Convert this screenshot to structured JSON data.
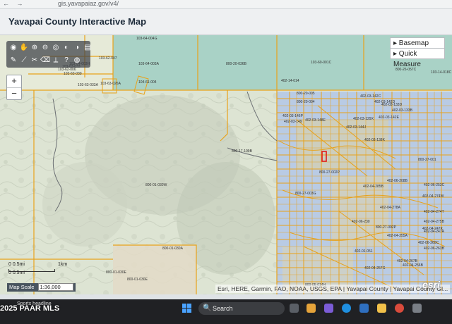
{
  "browser": {
    "nav_icons": "← →",
    "url": "gis.yavapaiaz.gov/v4/"
  },
  "app": {
    "title": "Yavapai County Interactive Map"
  },
  "panel": {
    "basemap_label": "▸ Basemap",
    "quick_measure_label": "▸ Quick Measure"
  },
  "zoom": {
    "in_label": "+",
    "out_label": "−"
  },
  "toolbar": {
    "tools": [
      {
        "name": "identify-icon",
        "glyph": "◉"
      },
      {
        "name": "pan-hand-icon",
        "glyph": "✋"
      },
      {
        "name": "zoom-in-tool-icon",
        "glyph": "⊕"
      },
      {
        "name": "zoom-out-tool-icon",
        "glyph": "⊖"
      },
      {
        "name": "full-extent-icon",
        "glyph": "◎"
      },
      {
        "name": "previous-extent-icon",
        "glyph": "◐"
      },
      {
        "name": "next-extent-icon",
        "glyph": "◑"
      },
      {
        "name": "print-icon",
        "glyph": "▤"
      },
      {
        "name": "draw-pencil-icon",
        "glyph": "✎"
      },
      {
        "name": "measure-icon",
        "glyph": "⟋"
      },
      {
        "name": "scissors-icon",
        "glyph": "✂"
      },
      {
        "name": "eraser-icon",
        "glyph": "⌫"
      },
      {
        "name": "pipe-icon",
        "glyph": "⟂"
      },
      {
        "name": "help-icon",
        "glyph": "?"
      },
      {
        "name": "globe-icon",
        "glyph": "◍"
      }
    ]
  },
  "map": {
    "parcel_labels": [
      "103-64-004G",
      "103-62-007",
      "103-64-003A",
      "103-62-006",
      "103-63-030",
      "103-63-033",
      "103-63-033A",
      "104-61-004",
      "103-63-026A",
      "103-64-003H",
      "800-20-036B",
      "103-60-001C",
      "800-26-057C",
      "103-14-018C",
      "402-14-014",
      "800-20-005",
      "800-20-004",
      "402-03-142C",
      "402-03-142D",
      "402-03-133D",
      "402-03-133B",
      "402-03-129X",
      "402-03-146P",
      "402-03-149",
      "402-03-148E",
      "402-03-142E",
      "402-03-144J",
      "402-03-138K",
      "800-27-001",
      "800-17-109B",
      "800-27-002P",
      "800-27-003G",
      "402-06-208B",
      "402-04-285B",
      "402-04-274W",
      "402-06-253C",
      "402-04-278A",
      "402-04-274T",
      "402-04-275B",
      "402-04-247K",
      "800-27-002P",
      "402-06-230",
      "402-04-247A",
      "402-04-255A",
      "402-06-260C",
      "402-06-263B",
      "402-01-051",
      "402-04-267B",
      "402-04-256B",
      "402-04-257G",
      "800-05-014H",
      "800-01-030W",
      "800-01-030E",
      "800-01-030A",
      "800-01-030E"
    ]
  },
  "scale": {
    "left_label": "0 0.5mi",
    "right_label": "1km",
    "bottom_label": "0 0.5mi",
    "map_scale_label": "Map Scale",
    "map_scale_value": "1:36,000"
  },
  "attribution": "Esri, HERE, Garmin, FAO, NOAA, USGS, EPA | Yavapai County | Yavapai County GI...",
  "esri_logo": "esri",
  "taskbar": {
    "watermark": "2025 PAAR MLS",
    "weather": "Sports headline",
    "search_label": "Search",
    "search_icon": "🔍"
  },
  "colors": {
    "parcel_line": "#e8a21a",
    "terrain": "#dfe6d6",
    "blue_parcel": "#b6c8e4",
    "teal_parcel": "#a9d2c6",
    "highlight_parcel": "#e01b1b"
  }
}
